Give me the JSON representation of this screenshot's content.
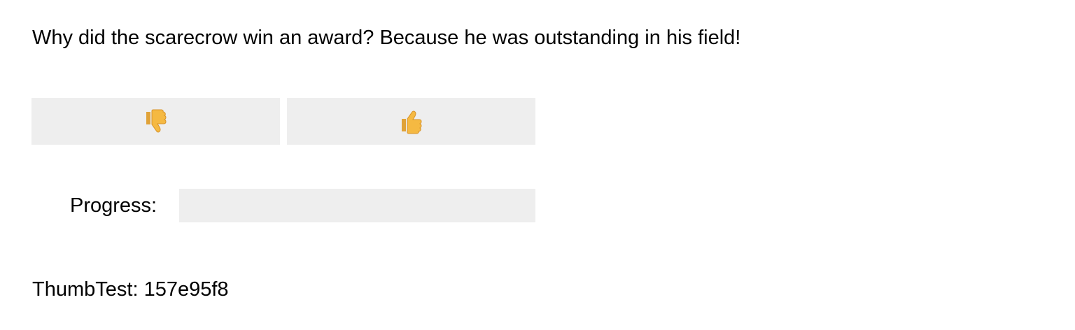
{
  "joke": {
    "text": "Why did the scarecrow win an award? Because he was outstanding in his field!"
  },
  "vote": {
    "down_icon": "thumbs-down-icon",
    "up_icon": "thumbs-up-icon",
    "emoji_color": "#f2b23c"
  },
  "progress": {
    "label": "Progress:",
    "value": 0
  },
  "footer": {
    "label": "ThumbTest:",
    "id": "157e95f8"
  }
}
